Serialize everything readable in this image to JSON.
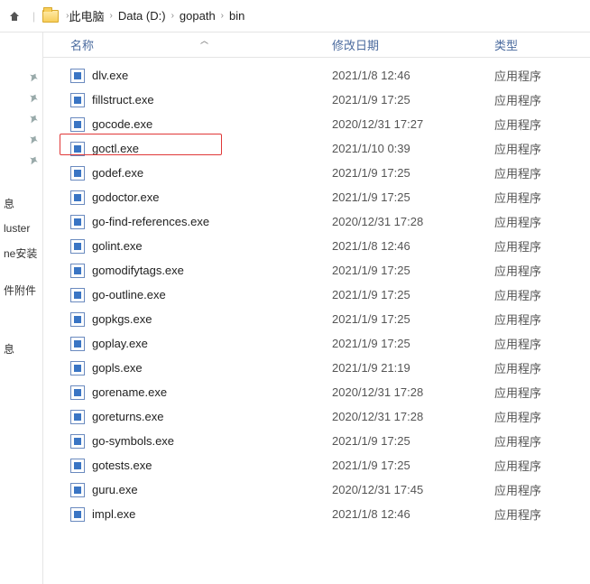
{
  "breadcrumb": {
    "items": [
      "此电脑",
      "Data (D:)",
      "gopath",
      "bin"
    ]
  },
  "columns": {
    "name": "名称",
    "date": "修改日期",
    "type": "类型"
  },
  "sidebar": {
    "pins": [
      "📌",
      "📌",
      "📌",
      "📌",
      "📌"
    ],
    "items": [
      "息",
      "luster",
      "ne安装",
      "",
      "件附件",
      "",
      "",
      "",
      "息"
    ]
  },
  "files": [
    {
      "name": "dlv.exe",
      "date": "2021/1/8 12:46",
      "type": "应用程序"
    },
    {
      "name": "fillstruct.exe",
      "date": "2021/1/9 17:25",
      "type": "应用程序"
    },
    {
      "name": "gocode.exe",
      "date": "2020/12/31 17:27",
      "type": "应用程序"
    },
    {
      "name": "goctl.exe",
      "date": "2021/1/10 0:39",
      "type": "应用程序"
    },
    {
      "name": "godef.exe",
      "date": "2021/1/9 17:25",
      "type": "应用程序"
    },
    {
      "name": "godoctor.exe",
      "date": "2021/1/9 17:25",
      "type": "应用程序"
    },
    {
      "name": "go-find-references.exe",
      "date": "2020/12/31 17:28",
      "type": "应用程序"
    },
    {
      "name": "golint.exe",
      "date": "2021/1/8 12:46",
      "type": "应用程序"
    },
    {
      "name": "gomodifytags.exe",
      "date": "2021/1/9 17:25",
      "type": "应用程序"
    },
    {
      "name": "go-outline.exe",
      "date": "2021/1/9 17:25",
      "type": "应用程序"
    },
    {
      "name": "gopkgs.exe",
      "date": "2021/1/9 17:25",
      "type": "应用程序"
    },
    {
      "name": "goplay.exe",
      "date": "2021/1/9 17:25",
      "type": "应用程序"
    },
    {
      "name": "gopls.exe",
      "date": "2021/1/9 21:19",
      "type": "应用程序"
    },
    {
      "name": "gorename.exe",
      "date": "2020/12/31 17:28",
      "type": "应用程序"
    },
    {
      "name": "goreturns.exe",
      "date": "2020/12/31 17:28",
      "type": "应用程序"
    },
    {
      "name": "go-symbols.exe",
      "date": "2021/1/9 17:25",
      "type": "应用程序"
    },
    {
      "name": "gotests.exe",
      "date": "2021/1/9 17:25",
      "type": "应用程序"
    },
    {
      "name": "guru.exe",
      "date": "2020/12/31 17:45",
      "type": "应用程序"
    },
    {
      "name": "impl.exe",
      "date": "2021/1/8 12:46",
      "type": "应用程序"
    }
  ],
  "highlight_index": 3
}
